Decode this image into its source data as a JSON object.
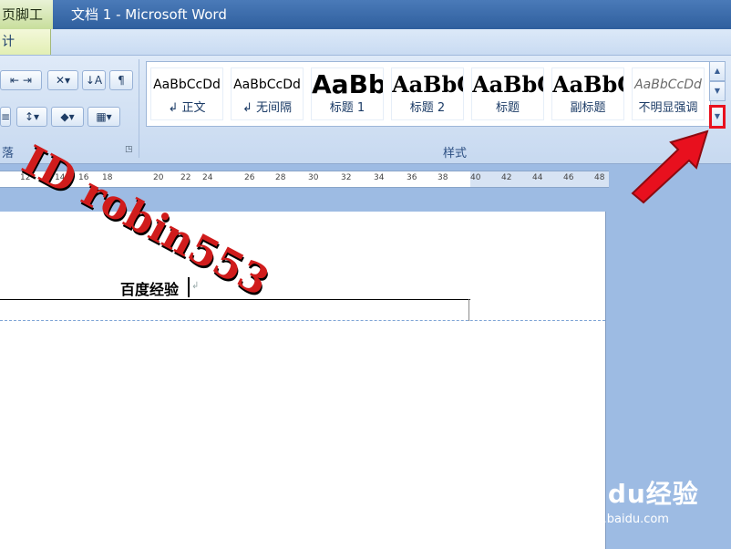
{
  "window": {
    "context_tab": "页脚工具",
    "title": "文档 1 - Microsoft Word"
  },
  "tabs": {
    "design": "计"
  },
  "ribbon": {
    "paragraph_group": "落",
    "styles_group": "样式",
    "styles": [
      {
        "preview": "AaBbCcDd",
        "name": "↲ 正文"
      },
      {
        "preview": "AaBbCcDd",
        "name": "↲ 无间隔"
      },
      {
        "preview": "AaBb",
        "name": "标题 1"
      },
      {
        "preview": "AaBbC",
        "name": "标题 2"
      },
      {
        "preview": "AaBbC",
        "name": "标题"
      },
      {
        "preview": "AaBbC",
        "name": "副标题"
      },
      {
        "preview": "AaBbCcDd",
        "name": "不明显强调"
      }
    ]
  },
  "ruler": {
    "ticks": [
      "12",
      "14",
      "16",
      "18",
      "20",
      "22",
      "24",
      "26",
      "28",
      "30",
      "32",
      "34",
      "36",
      "38",
      "40",
      "42",
      "44",
      "46",
      "48"
    ]
  },
  "document": {
    "header_text": "百度经验",
    "para_mark": "↲"
  },
  "overlays": {
    "watermark": "ID robin553",
    "logo_text": "Baidu经验",
    "logo_url": "jingyan.baidu.com"
  },
  "colors": {
    "highlight": "#e8101e",
    "arrow": "#e8101e"
  }
}
